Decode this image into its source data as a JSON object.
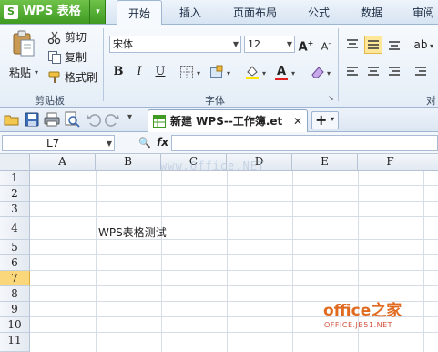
{
  "app": {
    "name": "WPS 表格",
    "logo_letter": "S"
  },
  "menu": {
    "tabs": [
      "开始",
      "插入",
      "页面布局",
      "公式",
      "数据",
      "审阅"
    ],
    "active": "开始"
  },
  "ribbon": {
    "clipboard": {
      "paste": "粘贴",
      "cut": "剪切",
      "copy": "复制",
      "format_painter": "格式刷",
      "group_label": "剪贴板"
    },
    "font": {
      "font_name": "宋体",
      "font_size": "12",
      "bold": "B",
      "italic": "I",
      "underline": "U",
      "group_label": "字体"
    },
    "align": {
      "group_label": "对"
    }
  },
  "doc_tab": {
    "title": "新建 WPS--工作簿.et"
  },
  "formula_bar": {
    "name_box": "L7",
    "fx": "fx",
    "zoom_icon": "🔍",
    "value": ""
  },
  "grid": {
    "columns": [
      "A",
      "B",
      "C",
      "D",
      "E",
      "F"
    ],
    "rows": [
      "1",
      "2",
      "3",
      "4",
      "5",
      "6",
      "7",
      "8",
      "9",
      "10",
      "11"
    ],
    "active_row": "7",
    "cells": {
      "B4": "WPS表格测试"
    }
  },
  "overlays": {
    "watermark": "www.Office.NET",
    "brand_main": "office之家",
    "brand_sub": "OFFICE.JB51.NET"
  },
  "colors": {
    "app_green": "#3f9b22",
    "active_row": "#fbd77b",
    "brand_orange": "#e06a1f"
  }
}
